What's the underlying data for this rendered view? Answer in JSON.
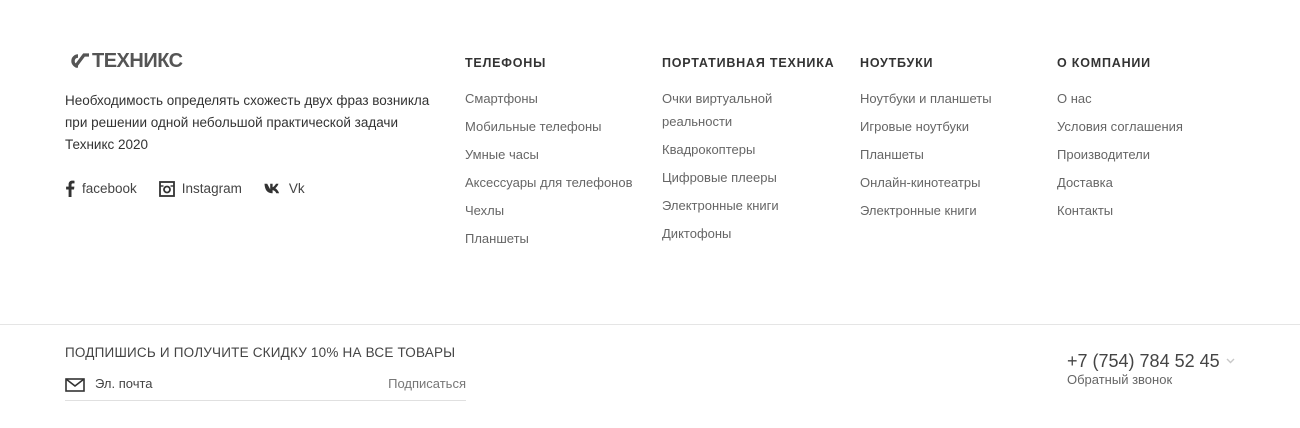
{
  "brand": {
    "logo_text": "ТЕХНИКС",
    "about": "Необходимость определять схожесть двух фраз возникла при решении одной небольшой практической задачи",
    "copyright": "Техникс 2020"
  },
  "social": [
    {
      "label": "facebook",
      "icon": "facebook-icon"
    },
    {
      "label": "Instagram",
      "icon": "instagram-icon"
    },
    {
      "label": "Vk",
      "icon": "vk-icon"
    }
  ],
  "columns": [
    {
      "title": "ТЕЛЕФОНЫ",
      "items": [
        "Смартфоны",
        "Мобильные телефоны",
        "Умные часы",
        "Аксессуары для телефонов",
        "Чехлы",
        "Планшеты"
      ]
    },
    {
      "title": "ПОРТАТИВНАЯ ТЕХНИКА",
      "items": [
        "Очки виртуальной реальности",
        "Квадрокоптеры",
        "Цифровые плееры",
        "Электронные книги",
        "Диктофоны"
      ]
    },
    {
      "title": "НОУТБУКИ",
      "items": [
        "Ноутбуки и планшеты",
        "Игровые ноутбуки",
        "Планшеты",
        "Онлайн-кинотеатры",
        "Электронные книги"
      ]
    },
    {
      "title": "О КОМПАНИИ",
      "items": [
        "О нас",
        "Условия соглашения",
        "Производители",
        "Доставка",
        "Контакты"
      ]
    }
  ],
  "subscribe": {
    "title": "ПОДПИШИСЬ И ПОЛУЧИТЕ СКИДКУ 10% НА ВСЕ ТОВАРЫ",
    "placeholder": "Эл. почта",
    "button": "Подписаться"
  },
  "contact": {
    "phone": "+7 (754) 784 52 45",
    "callback": "Обратный звонок"
  },
  "colors": {
    "text": "#333333",
    "muted": "#666666",
    "divider": "#e5e5e5"
  }
}
